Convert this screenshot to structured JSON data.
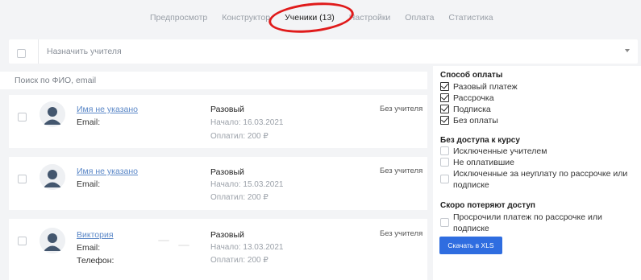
{
  "tabs": [
    {
      "label": "Предпросмотр",
      "active": false
    },
    {
      "label": "Конструктор",
      "active": false
    },
    {
      "label": "Ученики (13)",
      "active": true
    },
    {
      "label": "Настройки",
      "active": false
    },
    {
      "label": "Оплата",
      "active": false
    },
    {
      "label": "Статистика",
      "active": false
    }
  ],
  "assign": {
    "placeholder": "Назначить учителя"
  },
  "search": {
    "placeholder": "Поиск по ФИО, email"
  },
  "students": [
    {
      "name": "Имя не указано",
      "email_label": "Email:",
      "payment_type": "Разовый",
      "start": "Начало: 16.03.2021",
      "paid": "Оплатил: 200 ₽",
      "teacher": "Без учителя"
    },
    {
      "name": "Имя не указано",
      "email_label": "Email:",
      "payment_type": "Разовый",
      "start": "Начало: 15.03.2021",
      "paid": "Оплатил: 200 ₽",
      "teacher": "Без учителя"
    },
    {
      "name": "Виктория",
      "email_label": "Email:",
      "phone_label": "Телефон:",
      "payment_type": "Разовый",
      "start": "Начало: 13.03.2021",
      "paid": "Оплатил: 200 ₽",
      "teacher": "Без учителя"
    }
  ],
  "filters": {
    "payment": {
      "title": "Способ оплаты",
      "options": [
        {
          "label": "Разовый платеж",
          "checked": true
        },
        {
          "label": "Рассрочка",
          "checked": true
        },
        {
          "label": "Подписка",
          "checked": true
        },
        {
          "label": "Без оплаты",
          "checked": true
        }
      ]
    },
    "no_access": {
      "title": "Без доступа к курсу",
      "options": [
        {
          "label": "Исключенные учителем",
          "checked": false
        },
        {
          "label": "Не оплатившие",
          "checked": false
        },
        {
          "label": "Исключенные за неуплату по рассрочке или подписке",
          "checked": false
        }
      ]
    },
    "losing": {
      "title": "Скоро потеряют доступ",
      "options": [
        {
          "label": "Просрочили платеж по рассрочке или подписке",
          "checked": false
        }
      ]
    },
    "export_button": "Скачать в XLS"
  },
  "colors": {
    "accent": "#2f6de0",
    "link": "#5a87c7",
    "annotation": "#e01b1b"
  }
}
